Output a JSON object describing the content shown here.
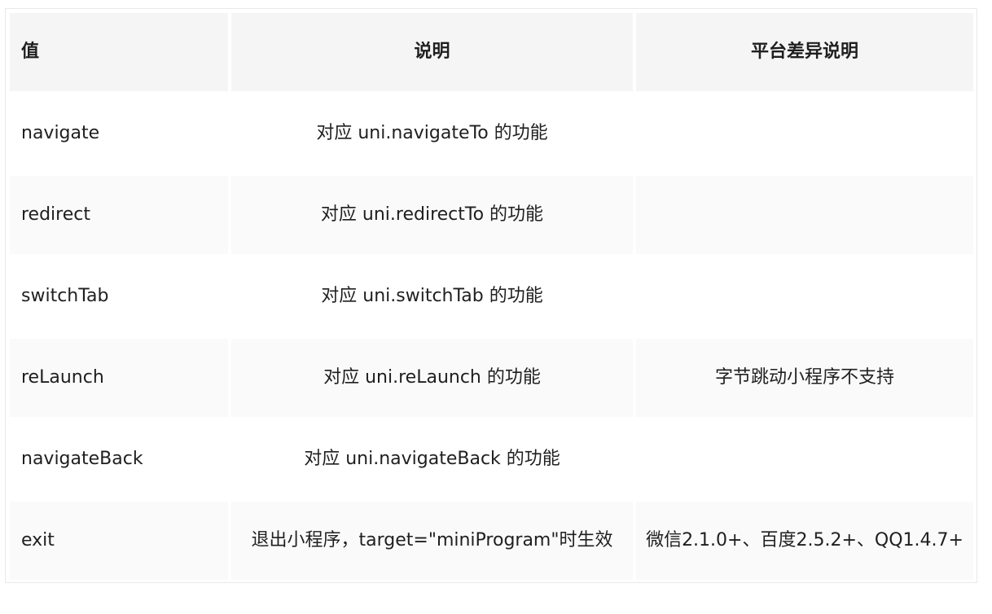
{
  "table": {
    "headers": [
      "值",
      "说明",
      "平台差异说明"
    ],
    "rows": [
      {
        "value": "navigate",
        "description": "对应 uni.navigateTo 的功能",
        "platform": ""
      },
      {
        "value": "redirect",
        "description": "对应 uni.redirectTo 的功能",
        "platform": ""
      },
      {
        "value": "switchTab",
        "description": "对应 uni.switchTab 的功能",
        "platform": ""
      },
      {
        "value": "reLaunch",
        "description": "对应 uni.reLaunch 的功能",
        "platform": "字节跳动小程序不支持"
      },
      {
        "value": "navigateBack",
        "description": "对应 uni.navigateBack 的功能",
        "platform": ""
      },
      {
        "value": "exit",
        "description": "退出小程序，target=\"miniProgram\"时生效",
        "platform": "微信2.1.0+、百度2.5.2+、QQ1.4.7+"
      }
    ]
  },
  "colors": {
    "header_bg": "#f5f5f5",
    "alt_row_bg": "#fafafa",
    "row_bg": "#ffffff",
    "border": "#e9e9e9"
  }
}
